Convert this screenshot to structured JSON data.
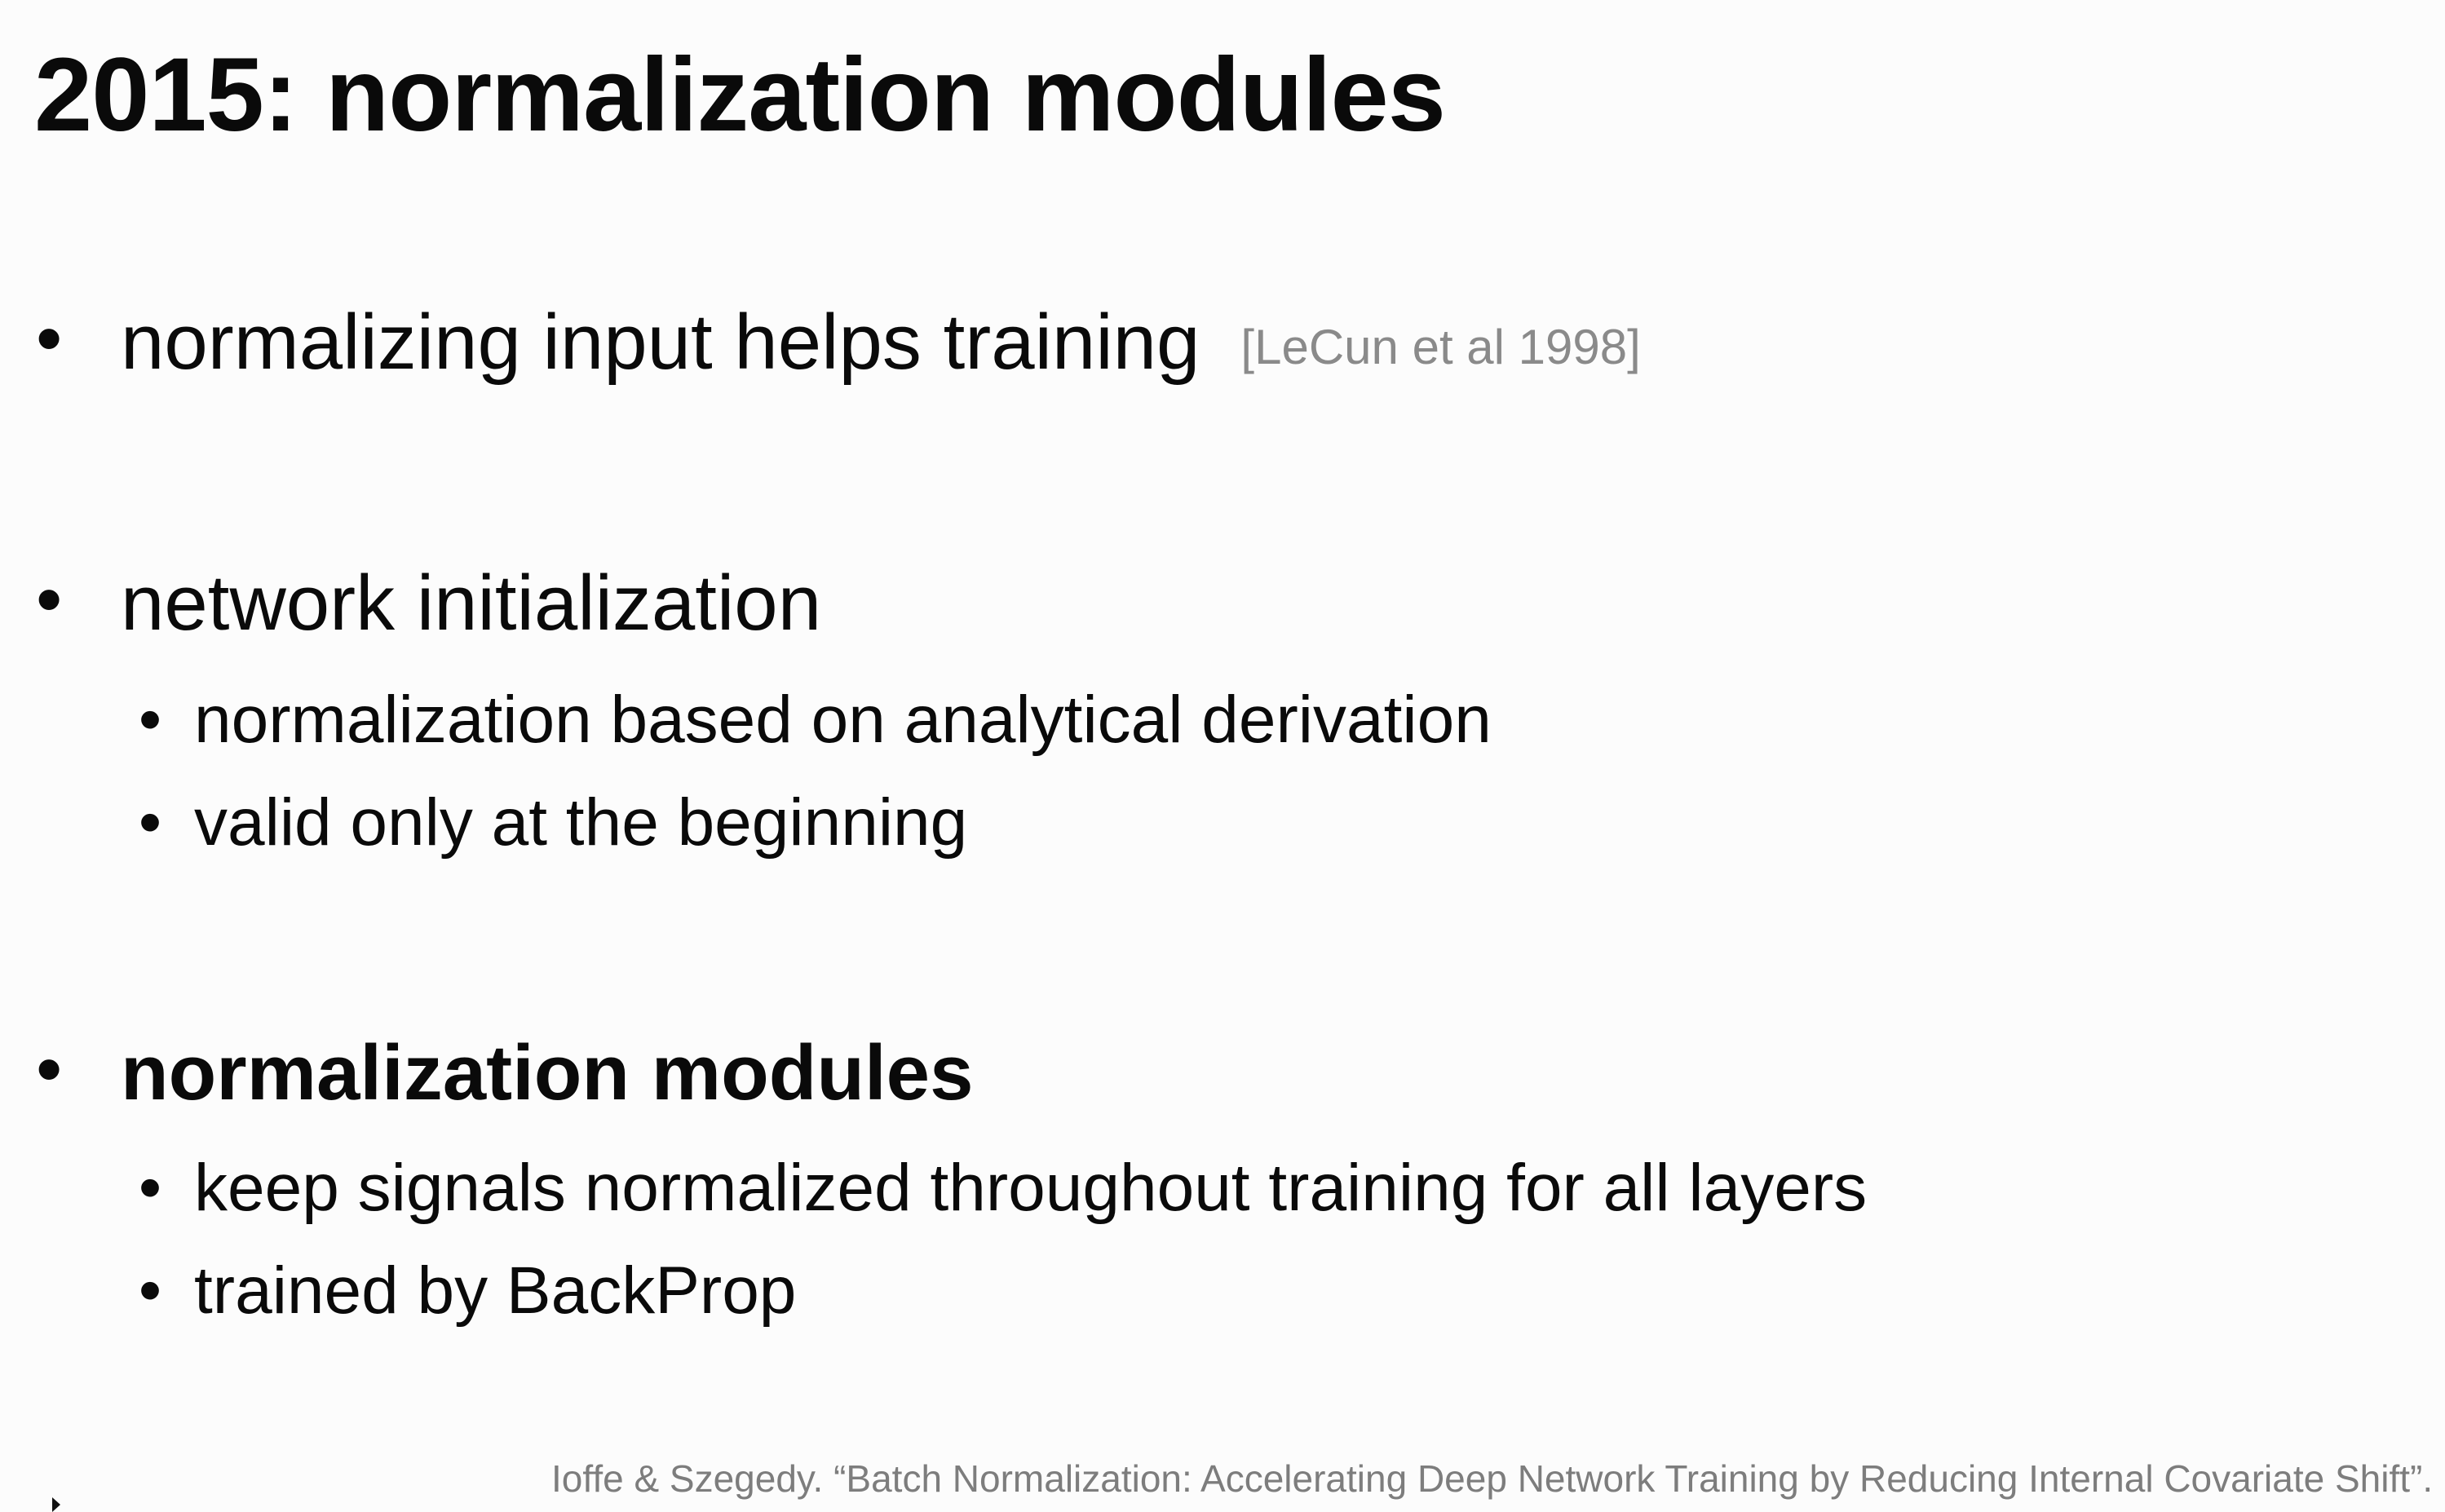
{
  "slide": {
    "title": "2015: normalization modules",
    "bullet_glyph": "•",
    "bullets": [
      {
        "text": "normalizing input helps training",
        "citation": "[LeCun et al 1998]",
        "subitems": []
      },
      {
        "text": "network initialization",
        "subitems": [
          "normalization based on analytical derivation",
          "valid only at the beginning"
        ]
      },
      {
        "text": "normalization modules",
        "emphasis": "bold",
        "subitems": [
          "keep signals normalized throughout training for all layers",
          "trained by BackProp"
        ]
      }
    ],
    "footer_citation": "Ioffe & Szegedy. “Batch Normalization: Accelerating Deep Network Training by Reducing Internal Covariate Shift”. I"
  },
  "colors": {
    "background": "#fcfcfc",
    "text": "#0a0a0a",
    "citation": "#8a8a8a",
    "footer": "#7d7d7d"
  },
  "icons": {
    "cursor": "mouse-pointer-icon"
  }
}
